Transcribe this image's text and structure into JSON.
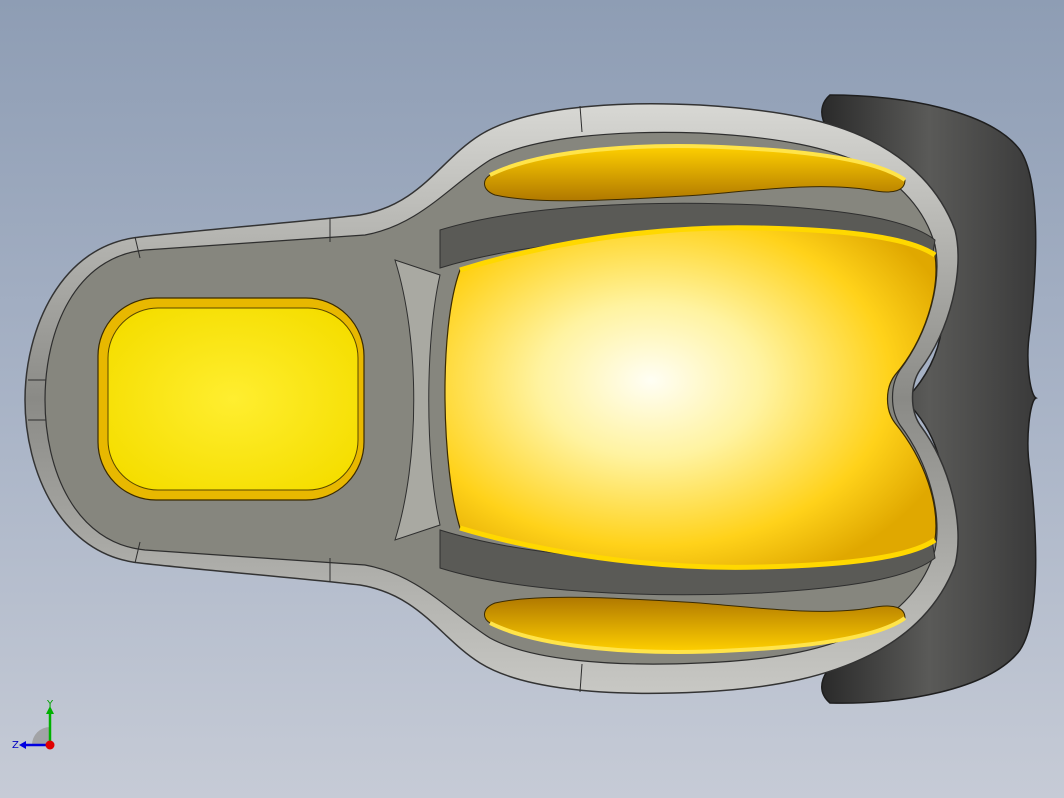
{
  "viewport": {
    "background_top": "#8e9db4",
    "background_bottom": "#c6cbd6"
  },
  "model": {
    "name": "seat-shell",
    "colors": {
      "shell_gray": "#86867e",
      "rim_light": "#e8e8e6",
      "rim_dark": "#4a4a48",
      "cushion_yellow": "#ffe800",
      "cushion_highlight": "#fffbe6",
      "cushion_deep": "#d49a00",
      "back_dark": "#3f3f3f"
    }
  },
  "triad": {
    "y_label": "Y",
    "z_label": "Z",
    "x_color": "#e00000",
    "y_color": "#00b000",
    "z_color": "#0000e0"
  }
}
